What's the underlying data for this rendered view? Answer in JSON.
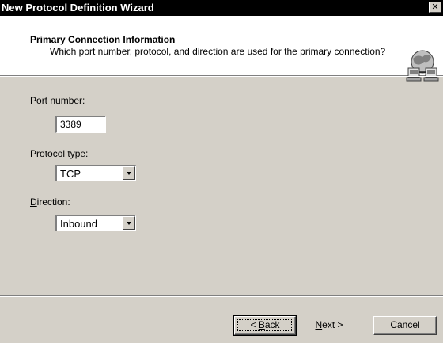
{
  "window": {
    "title": "New Protocol Definition Wizard",
    "close_label": "✕"
  },
  "header": {
    "title": "Primary Connection Information",
    "subtitle": "Which port number, protocol, and direction are used for the primary connection?",
    "icon": "network-wizard-icon"
  },
  "form": {
    "port": {
      "label_access_key": "P",
      "label_rest": "ort number:",
      "value": "3389"
    },
    "protocol": {
      "label_before": "Pro",
      "label_access_key": "t",
      "label_after": "ocol type:",
      "value": "TCP"
    },
    "direction": {
      "label_access_key": "D",
      "label_rest": "irection:",
      "value": "Inbound"
    }
  },
  "buttons": {
    "back": {
      "prefix": "< ",
      "access_key": "B",
      "rest": "ack"
    },
    "next": {
      "access_key": "N",
      "rest": "ext >"
    },
    "cancel": "Cancel"
  },
  "colors": {
    "titlebar": "#000000",
    "dialog_face": "#d4d0c8",
    "header_bg": "#ffffff"
  }
}
